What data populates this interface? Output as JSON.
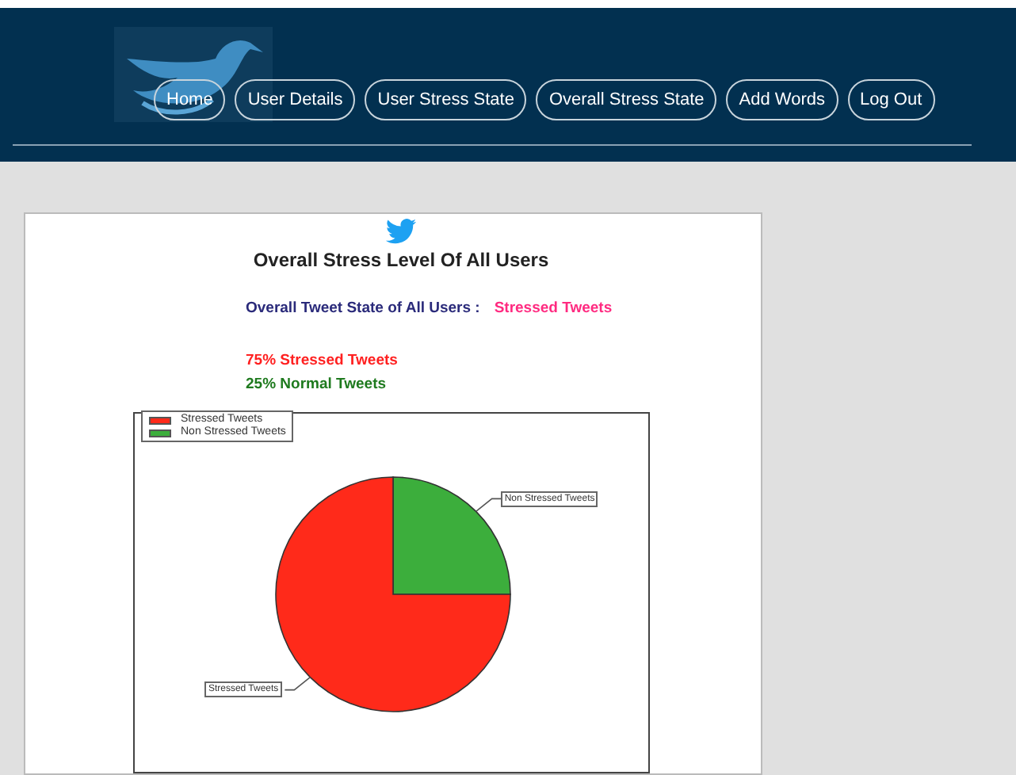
{
  "nav": [
    {
      "label": "Home",
      "selected": false
    },
    {
      "label": "User Details",
      "selected": false
    },
    {
      "label": "User Stress State",
      "selected": false
    },
    {
      "label": "Overall Stress State",
      "selected": false
    },
    {
      "label": "Add Words",
      "selected": false
    },
    {
      "label": "Log Out",
      "selected": false
    }
  ],
  "title": "Overall Stress Level Of All Users",
  "state": {
    "label": "Overall Tweet State of All Users :",
    "value": "Stressed Tweets"
  },
  "stats": [
    {
      "text": "75% Stressed Tweets",
      "color": "#ff2020"
    },
    {
      "text": "25% Normal Tweets",
      "color": "#1e7a1e"
    }
  ],
  "chart": {
    "chart_data": {
      "type": "pie",
      "categories": [
        "Stressed Tweets",
        "Non Stressed Tweets"
      ],
      "values": [
        75,
        25
      ],
      "colors": [
        "#ff2a1a",
        "#3cae3c"
      ],
      "legend": true
    }
  }
}
